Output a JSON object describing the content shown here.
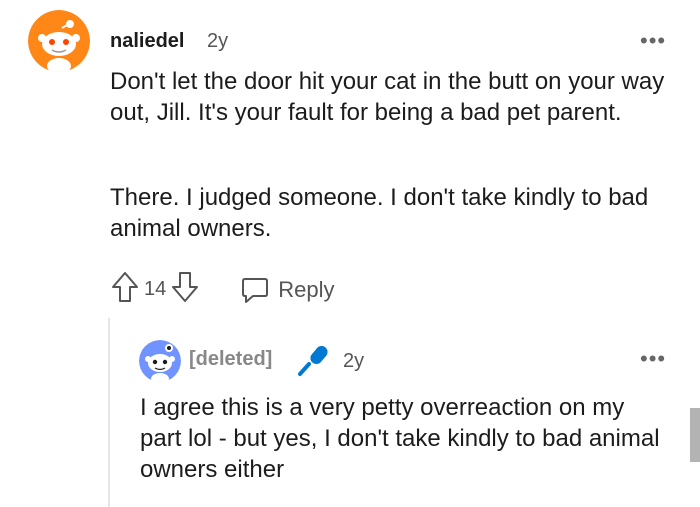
{
  "comment": {
    "username": "naliedel",
    "age": "2y",
    "more_label": "•••",
    "paragraphs": [
      "Don't let the door hit your cat in the butt on your way out, Jill. It's your fault for being a bad pet parent.",
      "There. I judged someone. I don't take kindly to bad animal owners."
    ],
    "vote_count": "14",
    "reply_label": "Reply"
  },
  "reply": {
    "username": "[deleted]",
    "age": "2y",
    "more_label": "•••",
    "text": "I agree this is a very petty overreaction on my part lol - but yes, I don't take kindly to bad animal owners either"
  },
  "colors": {
    "avatar_orange": "#ff8717",
    "mic_blue": "#0079d3",
    "text": "#1c1c1c",
    "muted": "#555555"
  },
  "icons": [
    "snoo-avatar-icon",
    "more-options-icon",
    "upvote-icon",
    "downvote-icon",
    "reply-icon",
    "microphone-icon"
  ]
}
